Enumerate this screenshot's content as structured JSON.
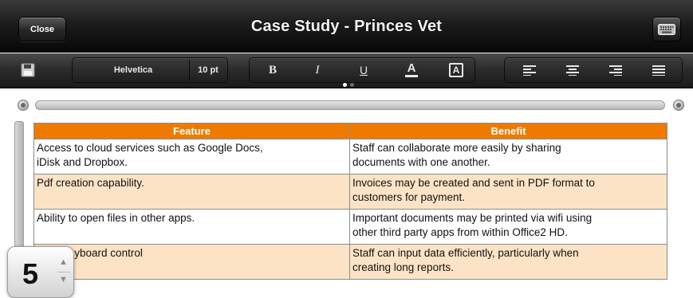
{
  "titlebar": {
    "close_label": "Close",
    "title": "Case Study - Princes Vet",
    "keyboard_icon": "keyboard-icon"
  },
  "toolbar": {
    "save_icon": "floppy-disk-icon",
    "font_name": "Helvetica",
    "font_size": "10 pt",
    "bold_label": "B",
    "italic_label": "I",
    "underline_label": "U",
    "text_color_label": "A",
    "highlight_label": "A",
    "align_icons": [
      "align-left-icon",
      "align-center-icon",
      "align-right-icon",
      "align-justify-icon"
    ],
    "page_indicator": {
      "pages": 2,
      "current": 1
    }
  },
  "document": {
    "table": {
      "headers": [
        "Feature",
        "Benefit"
      ],
      "header_color": "#ee7b00",
      "shade_color": "#fde3c6",
      "rows": [
        {
          "feature": [
            "Access to cloud services such as Google Docs,",
            "iDisk and Dropbox."
          ],
          "benefit": [
            "Staff can collaborate more easily by sharing",
            "documents with one another."
          ],
          "shaded": false
        },
        {
          "feature": [
            "Pdf creation capability."
          ],
          "benefit": [
            "Invoices may be created and sent in PDF format to",
            "customers for payment."
          ],
          "shaded": true
        },
        {
          "feature": [
            "Ability to open files in other apps."
          ],
          "benefit": [
            "Important documents may be printed via wifi using",
            "other third party apps from within Office2 HD."
          ],
          "shaded": false
        },
        {
          "feature": [
            "...nal keyboard control"
          ],
          "benefit": [
            "Staff can input data efficiently, particularly when",
            "creating long reports."
          ],
          "shaded": true
        }
      ]
    }
  },
  "font_size_popup": {
    "value": "5",
    "up_glyph": "▲",
    "down_glyph": "▼"
  }
}
